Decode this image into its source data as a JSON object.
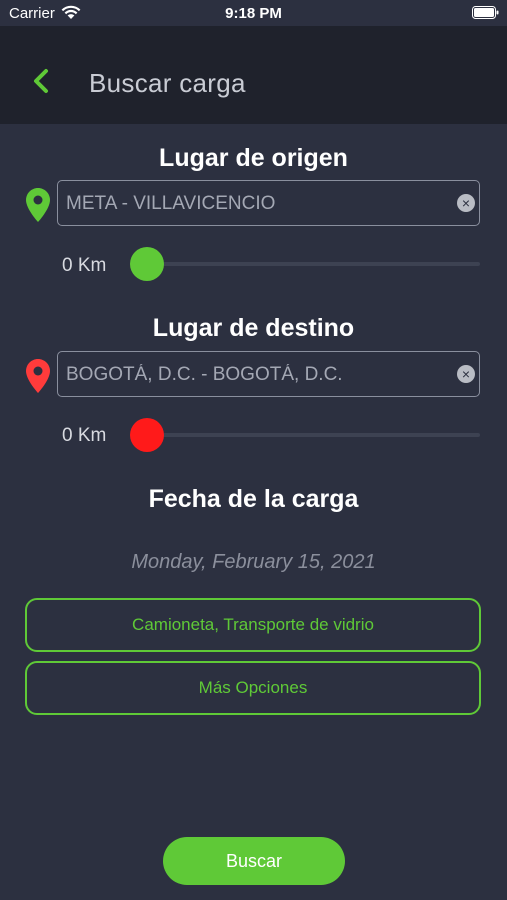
{
  "status_bar": {
    "carrier": "Carrier",
    "time": "9:18 PM"
  },
  "header": {
    "title": "Buscar carga"
  },
  "origin": {
    "title": "Lugar de origen",
    "value": "META - VILLAVICENCIO",
    "radius_label": "0 Km",
    "radius_km": 0,
    "color": "#5fc937"
  },
  "destination": {
    "title": "Lugar de destino",
    "value": "BOGOTÁ, D.C. - BOGOTÁ, D.C.",
    "radius_label": "0 Km",
    "radius_km": 0,
    "color": "#ff1a1a"
  },
  "date": {
    "title": "Fecha de la carga",
    "value": "Monday, February 15, 2021"
  },
  "buttons": {
    "vehicle": "Camioneta, Transporte de vidrio",
    "more_options": "Más Opciones",
    "search": "Buscar"
  },
  "colors": {
    "accent": "#5fc937",
    "background": "#2c3040",
    "header_background": "#1f222c"
  }
}
